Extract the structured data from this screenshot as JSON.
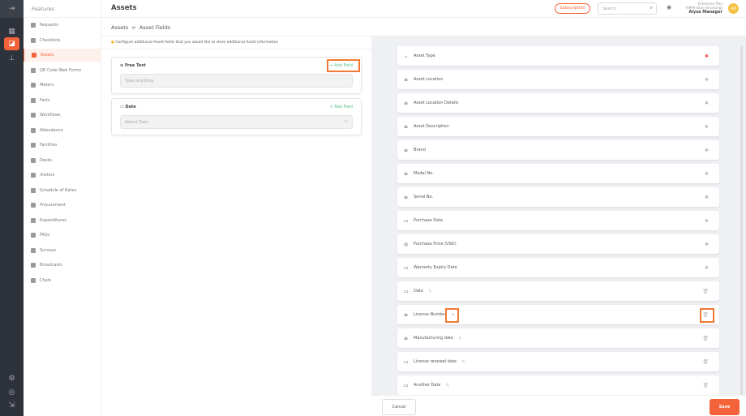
{
  "rail": {
    "toggle_icon": "collapse-arrow-icon",
    "icons": [
      "dashboard-grid-icon",
      "features-icon",
      "org-chart-icon"
    ],
    "bottom_icons": [
      "settings-icon",
      "support-icon",
      "logout-icon"
    ]
  },
  "features": {
    "title": "Features",
    "items": [
      {
        "label": "Requests"
      },
      {
        "label": "Checklists"
      },
      {
        "label": "Assets",
        "active": true
      },
      {
        "label": "QR Code Web Forms"
      },
      {
        "label": "Meters"
      },
      {
        "label": "Parts"
      },
      {
        "label": "Workflows"
      },
      {
        "label": "Attendance"
      },
      {
        "label": "Facilities"
      },
      {
        "label": "Desks"
      },
      {
        "label": "Visitors"
      },
      {
        "label": "Schedule of Rates"
      },
      {
        "label": "Procurement"
      },
      {
        "label": "Expenditures"
      },
      {
        "label": "FAQs"
      },
      {
        "label": "Surveys"
      },
      {
        "label": "Broadcasts"
      },
      {
        "label": "Chats"
      }
    ]
  },
  "header": {
    "title": "Assets",
    "subscription": "Subscription",
    "search_placeholder": "Search",
    "plan": "Enterprise Plan",
    "plan_days": "(9999 days remaining)",
    "user": "Alyza Manager",
    "avatar": "AM"
  },
  "breadcrumb": {
    "root": "Assets",
    "sep": ">",
    "current": "Asset Fields"
  },
  "left": {
    "tip": "Configure additional Asset fields that you would like to store additional Asset information",
    "cards": [
      {
        "label": "Free Text",
        "add": "+ Add Field",
        "placeholder": "Type anything"
      },
      {
        "label": "Date",
        "add": "+ Add Field",
        "placeholder": "Select Date"
      }
    ]
  },
  "fields": [
    {
      "label": "Asset Type",
      "icon": "chevron-down",
      "required": true
    },
    {
      "label": "Asset Location",
      "icon": "text"
    },
    {
      "label": "Asset Location Details",
      "icon": "text"
    },
    {
      "label": "Asset Description",
      "icon": "text"
    },
    {
      "label": "Brand",
      "icon": "text"
    },
    {
      "label": "Model No.",
      "icon": "text"
    },
    {
      "label": "Serial No.",
      "icon": "text"
    },
    {
      "label": "Purchase Date",
      "icon": "calendar"
    },
    {
      "label": "Purchase Price (USD)",
      "icon": "currency"
    },
    {
      "label": "Warranty Expiry Date",
      "icon": "calendar"
    },
    {
      "label": "Date",
      "icon": "calendar",
      "custom": true
    },
    {
      "label": "License Number",
      "icon": "text",
      "custom": true
    },
    {
      "label": "Manufacturing date",
      "icon": "text",
      "custom": true
    },
    {
      "label": "License renewal date",
      "icon": "calendar",
      "custom": true
    },
    {
      "label": "Another Date",
      "icon": "calendar",
      "custom": true
    }
  ],
  "footer": {
    "cancel": "Cancel",
    "save": "Save"
  },
  "colors": {
    "accent": "#f4623a",
    "add_field": "#5bbf8a",
    "highlight": "#f07a33"
  }
}
